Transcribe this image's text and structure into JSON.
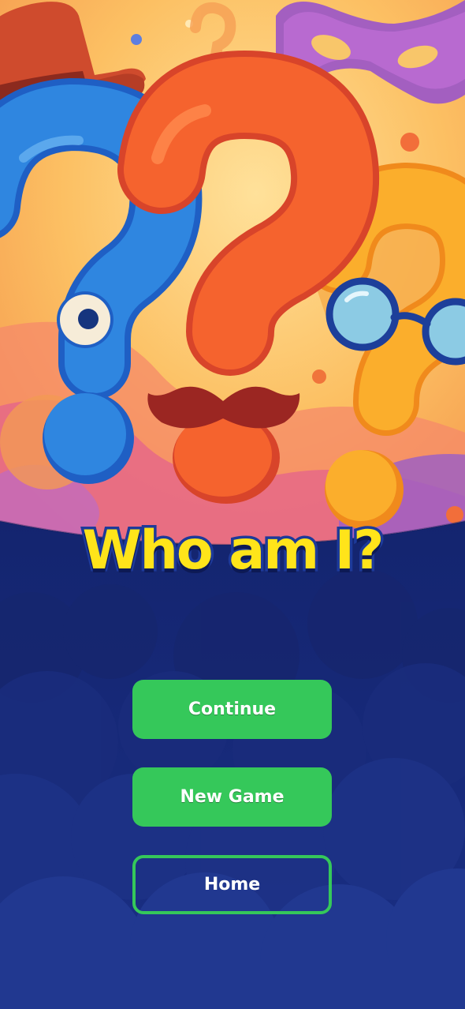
{
  "title": "Who am I?",
  "buttons": {
    "continue_label": "Continue",
    "new_game_label": "New Game",
    "home_label": "Home"
  },
  "colors": {
    "title_fill": "#ffe41a",
    "title_stroke": "#1d3a9a",
    "button_green": "#35c85a",
    "background_navy": "#13216a",
    "hero_background": "#fcbf5c"
  },
  "hero_icons": [
    "detective-hat-icon",
    "masquerade-mask-icon",
    "blue-question-mark-icon",
    "orange-question-mark-icon",
    "yellow-question-mark-icon",
    "mustache-icon",
    "glasses-icon",
    "eye-icon"
  ]
}
